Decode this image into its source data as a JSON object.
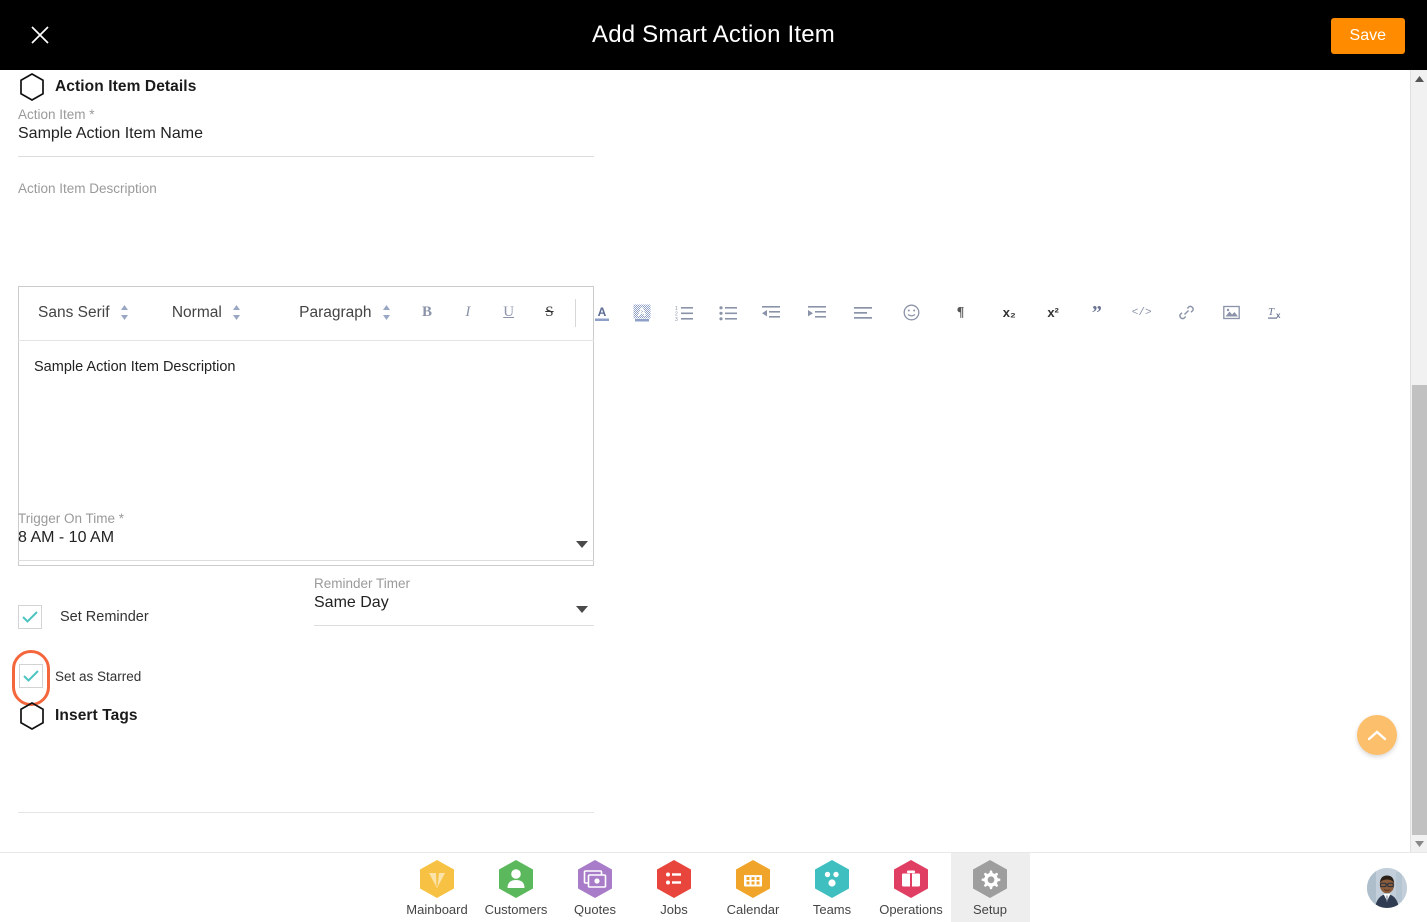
{
  "header": {
    "title": "Add Smart Action Item",
    "close_icon": "close-icon",
    "save_label": "Save",
    "save_color": "#ff8c00"
  },
  "sections": {
    "details": {
      "title": "Action Item Details",
      "icon": "hexagon-icon"
    },
    "insert_tags": {
      "title": "Insert Tags",
      "icon": "hexagon-icon"
    }
  },
  "fields": {
    "action_item": {
      "label": "Action Item *",
      "value": "Sample Action Item Name"
    },
    "description": {
      "label": "Action Item Description",
      "value": "Sample Action Item Description"
    },
    "trigger_on_time": {
      "label": "Trigger On Time *",
      "value": "8 AM - 10 AM"
    },
    "reminder_timer": {
      "label": "Reminder Timer",
      "value": "Same Day"
    }
  },
  "checkboxes": {
    "set_reminder": {
      "label": "Set Reminder",
      "checked": true
    },
    "set_as_starred": {
      "label": "Set as Starred",
      "checked": true,
      "focus_ring_color": "#f4663c"
    }
  },
  "editor": {
    "font_family_select": "Sans Serif",
    "font_size_select": "Normal",
    "block_format_select": "Paragraph",
    "buttons": [
      {
        "name": "bold-icon",
        "glyph": "B"
      },
      {
        "name": "italic-icon",
        "glyph": "I"
      },
      {
        "name": "underline-icon",
        "glyph": "U"
      },
      {
        "name": "strikethrough-icon",
        "glyph": "S"
      },
      {
        "name": "text-color-icon",
        "glyph": "A"
      },
      {
        "name": "background-color-icon",
        "glyph": "A"
      },
      {
        "name": "ordered-list-icon",
        "glyph": ""
      },
      {
        "name": "bullet-list-icon",
        "glyph": ""
      },
      {
        "name": "outdent-icon",
        "glyph": ""
      },
      {
        "name": "indent-icon",
        "glyph": ""
      },
      {
        "name": "align-icon",
        "glyph": ""
      },
      {
        "name": "emoji-icon",
        "glyph": ""
      },
      {
        "name": "text-direction-icon",
        "glyph": "¶"
      },
      {
        "name": "subscript-icon",
        "glyph": "x₂"
      },
      {
        "name": "superscript-icon",
        "glyph": "x²"
      },
      {
        "name": "blockquote-icon",
        "glyph": "”"
      },
      {
        "name": "code-block-icon",
        "glyph": "</>"
      },
      {
        "name": "link-icon",
        "glyph": ""
      },
      {
        "name": "image-icon",
        "glyph": ""
      },
      {
        "name": "clear-format-icon",
        "glyph": ""
      }
    ]
  },
  "scroll_top_button": {
    "icon": "chevron-up-icon",
    "color": "#fcbf6b"
  },
  "scrollbar": {
    "up_arrow": "triangle-up-icon",
    "down_arrow": "triangle-down-icon"
  },
  "bottom_nav": {
    "items": [
      {
        "label": "Mainboard",
        "icon": "mainboard-icon",
        "color": "#f7c244",
        "active": false
      },
      {
        "label": "Customers",
        "icon": "customers-icon",
        "color": "#5cb85c",
        "active": false
      },
      {
        "label": "Quotes",
        "icon": "quotes-icon",
        "color": "#a87cc8",
        "active": false
      },
      {
        "label": "Jobs",
        "icon": "jobs-icon",
        "color": "#e8453c",
        "active": false
      },
      {
        "label": "Calendar",
        "icon": "calendar-icon",
        "color": "#f0a429",
        "active": false
      },
      {
        "label": "Teams",
        "icon": "teams-icon",
        "color": "#3fbfbf",
        "active": false
      },
      {
        "label": "Operations",
        "icon": "operations-icon",
        "color": "#e03e62",
        "active": false
      },
      {
        "label": "Setup",
        "icon": "setup-icon",
        "color": "#9e9e9e",
        "active": true
      }
    ],
    "avatar": "user-avatar"
  }
}
